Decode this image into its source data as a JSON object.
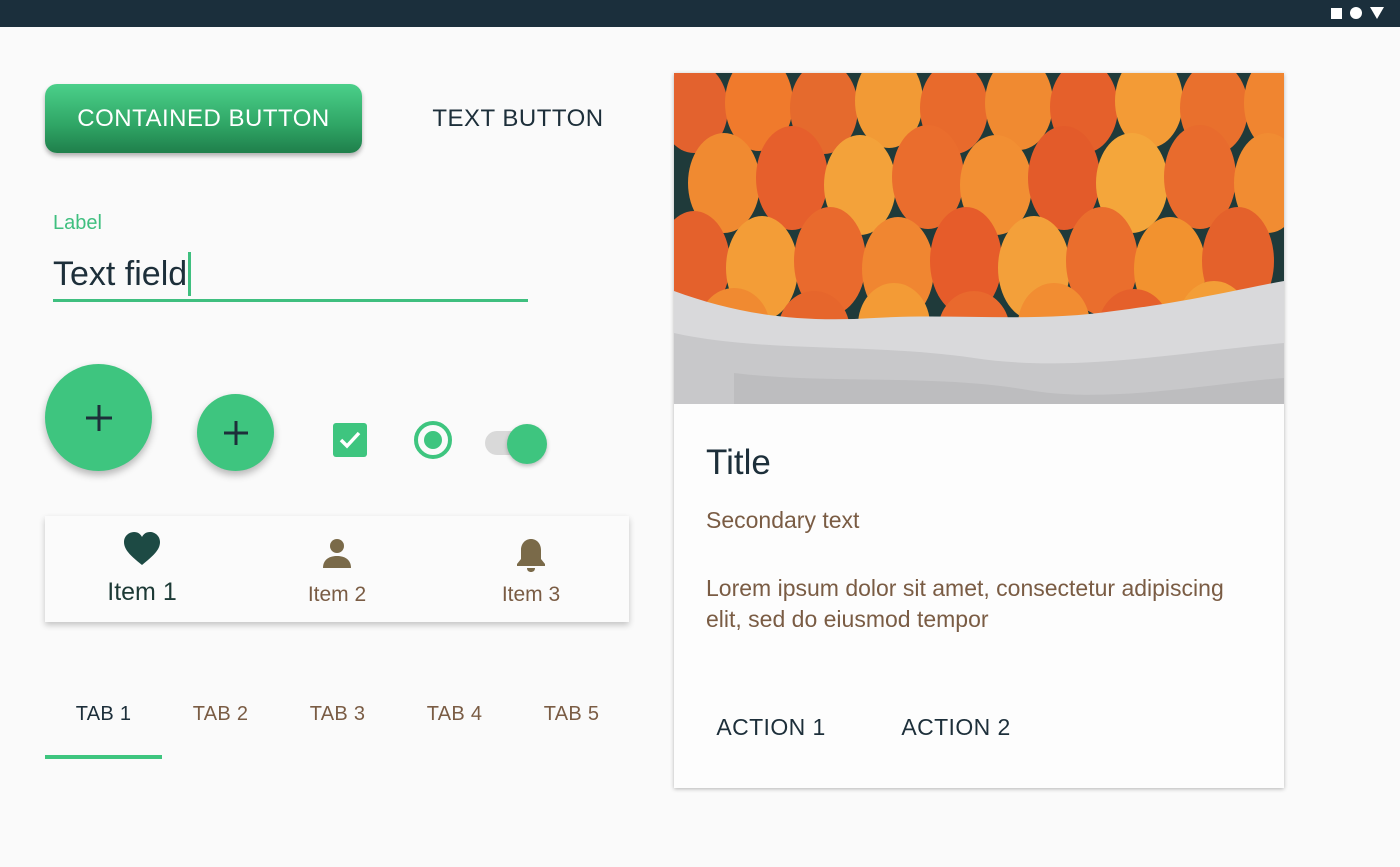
{
  "status_bar": {
    "icons": [
      "square-icon",
      "circle-icon",
      "triangle-icon"
    ]
  },
  "buttons": {
    "contained_label": "CONTAINED BUTTON",
    "text_label": "TEXT BUTTON"
  },
  "text_field": {
    "label": "Label",
    "value": "Text field"
  },
  "fabs": {
    "large_icon": "plus-icon",
    "small_icon": "plus-icon"
  },
  "controls": {
    "checkbox_checked": true,
    "radio_selected": true,
    "switch_on": true
  },
  "bottom_nav": {
    "items": [
      {
        "label": "Item 1",
        "icon": "heart-icon",
        "active": true
      },
      {
        "label": "Item 2",
        "icon": "person-icon",
        "active": false
      },
      {
        "label": "Item 3",
        "icon": "bell-icon",
        "active": false
      }
    ]
  },
  "tabs": {
    "items": [
      "TAB 1",
      "TAB 2",
      "TAB 3",
      "TAB 4",
      "TAB 5"
    ],
    "active_index": 0
  },
  "card": {
    "media": "tulips-image",
    "title": "Title",
    "secondary": "Secondary text",
    "body": "Lorem ipsum dolor sit amet, consectetur adipiscing elit, sed do eiusmod tempor",
    "actions": [
      "ACTION 1",
      "ACTION 2"
    ]
  },
  "colors": {
    "primary": "#3ec57f",
    "status_bar": "#1b2f3c",
    "text_primary": "#1d2f3a",
    "text_secondary": "#7a5c44"
  }
}
